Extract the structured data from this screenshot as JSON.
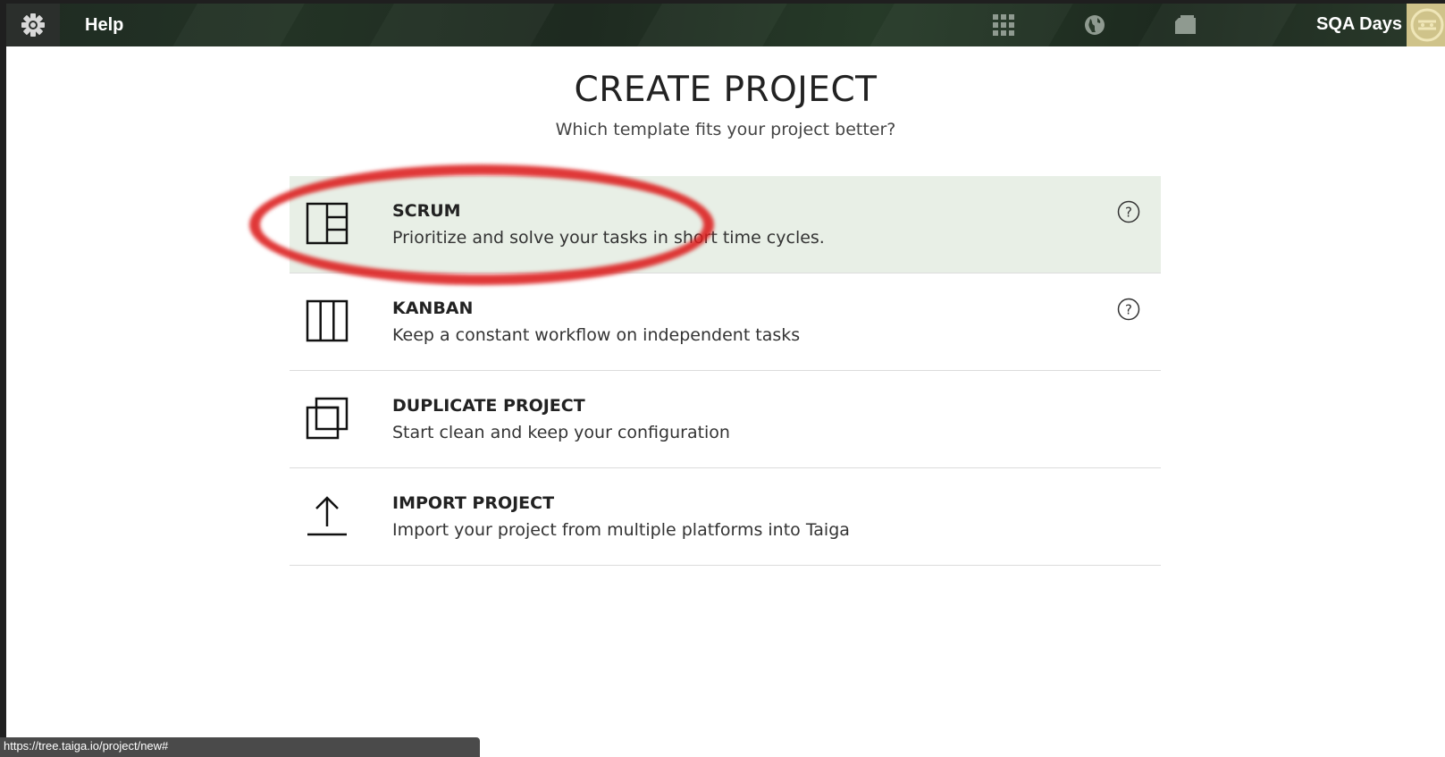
{
  "nav": {
    "help_label": "Help",
    "user_name": "SQA Days",
    "icons": [
      "grid-icon",
      "globe-icon",
      "folder-icon"
    ]
  },
  "header": {
    "title": "CREATE PROJECT",
    "subtitle": "Which template fits your project better?"
  },
  "templates": [
    {
      "title": "SCRUM",
      "description": "Prioritize and solve your tasks in short time cycles.",
      "icon": "scrum-board-icon",
      "has_help": true
    },
    {
      "title": "KANBAN",
      "description": "Keep a constant workflow on independent tasks",
      "icon": "kanban-columns-icon",
      "has_help": true
    },
    {
      "title": "DUPLICATE PROJECT",
      "description": "Start clean and keep your configuration",
      "icon": "duplicate-icon",
      "has_help": false
    },
    {
      "title": "IMPORT PROJECT",
      "description": "Import your project from multiple platforms into Taiga",
      "icon": "upload-arrow-icon",
      "has_help": false
    }
  ],
  "status_bar": {
    "url": "https://tree.taiga.io/project/new#"
  },
  "colors": {
    "active_row": "#e8efe6",
    "annotation": "#dc1c1c",
    "avatar": "#cfc38a"
  }
}
